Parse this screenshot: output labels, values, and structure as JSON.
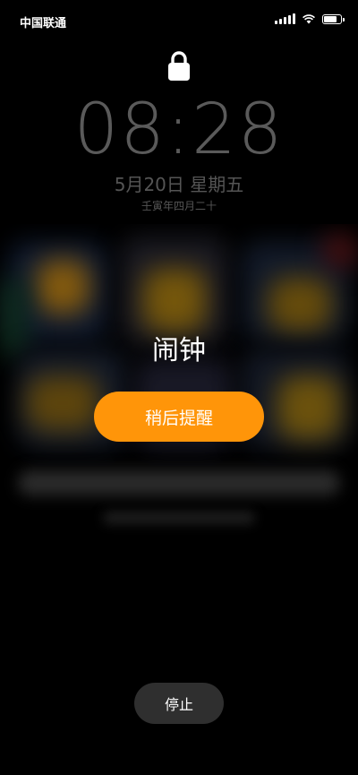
{
  "status_bar": {
    "carrier": "中国联通",
    "icons": [
      "signal-icon",
      "wifi-icon",
      "battery-icon"
    ],
    "battery_level": 0.9
  },
  "lock": {
    "icon": "lock-icon"
  },
  "clock": {
    "time": "08:28"
  },
  "date": {
    "gregorian": "5月20日 星期五",
    "lunar": "壬寅年四月二十"
  },
  "alarm": {
    "title": "闹钟",
    "snooze_label": "稍后提醒",
    "stop_label": "停止"
  },
  "colors": {
    "accent": "#ff9509",
    "stop_button_bg": "#2f2f2f",
    "clock_text": "#5a5a5a",
    "background": "#000000"
  }
}
